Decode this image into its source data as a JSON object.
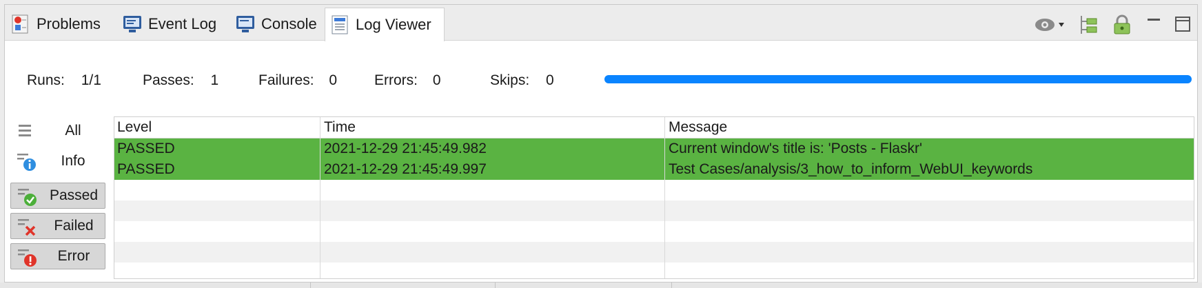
{
  "tabs": [
    {
      "label": "Problems",
      "icon": "problems-icon",
      "active": false
    },
    {
      "label": "Event Log",
      "icon": "event-log-icon",
      "active": false
    },
    {
      "label": "Console",
      "icon": "console-icon",
      "active": false
    },
    {
      "label": "Log Viewer",
      "icon": "log-viewer-icon",
      "active": true
    }
  ],
  "toolbar": {
    "icons": [
      "eye-dropdown-icon",
      "tree-view-icon",
      "lock-icon",
      "minimize-icon",
      "maximize-icon"
    ]
  },
  "stats": {
    "runs_label": "Runs:",
    "runs_value": "1/1",
    "passes_label": "Passes:",
    "passes_value": "1",
    "failures_label": "Failures:",
    "failures_value": "0",
    "errors_label": "Errors:",
    "errors_value": "0",
    "skips_label": "Skips:",
    "skips_value": "0",
    "progress_fraction": 1.0,
    "progress_color": "#0a84ff"
  },
  "filters": [
    {
      "label": "All",
      "icon": "list-icon",
      "pressed": false
    },
    {
      "label": "Info",
      "icon": "info-icon",
      "pressed": false
    },
    {
      "label": "Passed",
      "icon": "passed-check-icon",
      "pressed": true
    },
    {
      "label": "Failed",
      "icon": "failed-x-icon",
      "pressed": true
    },
    {
      "label": "Error",
      "icon": "error-icon",
      "pressed": true
    }
  ],
  "table": {
    "columns": [
      "Level",
      "Time",
      "Message"
    ],
    "rows": [
      {
        "level": "PASSED",
        "time": "2021-12-29 21:45:49.982",
        "message": "Current window's title is: 'Posts - Flaskr'"
      },
      {
        "level": "PASSED",
        "time": "2021-12-29 21:45:49.997",
        "message": "Test Cases/analysis/3_how_to_inform_WebUI_keywords"
      }
    ],
    "passed_color": "#5ab342"
  }
}
